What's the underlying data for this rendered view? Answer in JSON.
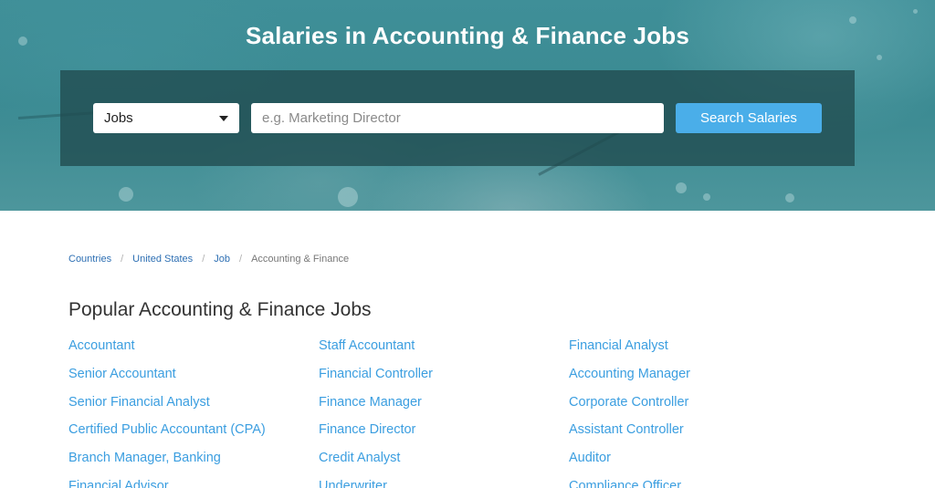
{
  "hero": {
    "title": "Salaries in Accounting & Finance Jobs"
  },
  "search": {
    "category_selected": "Jobs",
    "placeholder": "e.g. Marketing Director",
    "button_label": "Search Salaries"
  },
  "breadcrumb": {
    "items": [
      "Countries",
      "United States",
      "Job"
    ],
    "current": "Accounting & Finance",
    "separator": "/"
  },
  "section": {
    "title": "Popular Accounting & Finance Jobs",
    "jobs": [
      "Accountant",
      "Staff Accountant",
      "Financial Analyst",
      "Senior Accountant",
      "Financial Controller",
      "Accounting Manager",
      "Senior Financial Analyst",
      "Finance Manager",
      "Corporate Controller",
      "Certified Public Accountant (CPA)",
      "Finance Director",
      "Assistant Controller",
      "Branch Manager, Banking",
      "Credit Analyst",
      "Auditor",
      "Financial Advisor",
      "Underwriter",
      "Compliance Officer"
    ]
  },
  "colors": {
    "link": "#3b9ee0",
    "button": "#4aaee9",
    "breadcrumb_link": "#2d6fb3"
  }
}
